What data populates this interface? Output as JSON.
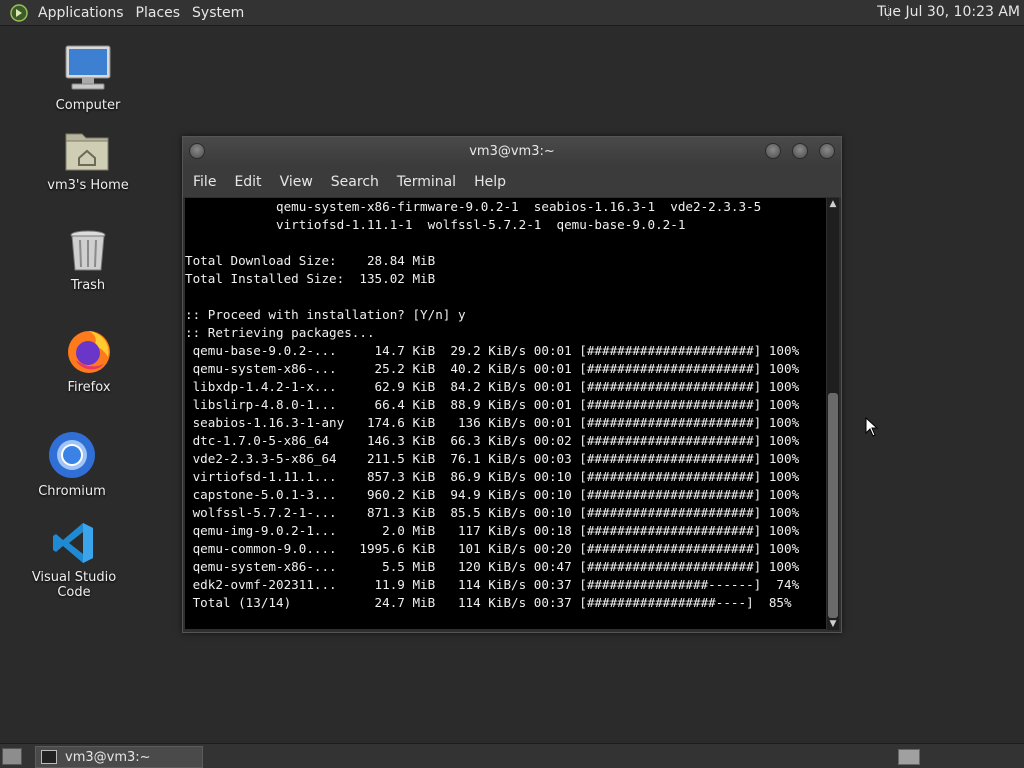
{
  "top_panel": {
    "menus": [
      "Applications",
      "Places",
      "System"
    ],
    "clock": "Tue Jul 30, 10:23 AM"
  },
  "desktop_icons": [
    {
      "label": "Computer",
      "icon": "computer-icon"
    },
    {
      "label": "vm3's Home",
      "icon": "home-folder-icon"
    },
    {
      "label": "Trash",
      "icon": "trash-icon"
    },
    {
      "label": "Firefox",
      "icon": "firefox-icon"
    },
    {
      "label": "Chromium",
      "icon": "chromium-icon"
    },
    {
      "label": "Visual Studio Code",
      "icon": "vscode-icon"
    }
  ],
  "terminal": {
    "title": "vm3@vm3:~",
    "menu": [
      "File",
      "Edit",
      "View",
      "Search",
      "Terminal",
      "Help"
    ],
    "lines": [
      "            qemu-system-x86-firmware-9.0.2-1  seabios-1.16.3-1  vde2-2.3.3-5",
      "            virtiofsd-1.11.1-1  wolfssl-5.7.2-1  qemu-base-9.0.2-1",
      "",
      "Total Download Size:    28.84 MiB",
      "Total Installed Size:  135.02 MiB",
      "",
      ":: Proceed with installation? [Y/n] y",
      ":: Retrieving packages...",
      " qemu-base-9.0.2-...     14.7 KiB  29.2 KiB/s 00:01 [######################] 100%",
      " qemu-system-x86-...     25.2 KiB  40.2 KiB/s 00:01 [######################] 100%",
      " libxdp-1.4.2-1-x...     62.9 KiB  84.2 KiB/s 00:01 [######################] 100%",
      " libslirp-4.8.0-1...     66.4 KiB  88.9 KiB/s 00:01 [######################] 100%",
      " seabios-1.16.3-1-any   174.6 KiB   136 KiB/s 00:01 [######################] 100%",
      " dtc-1.7.0-5-x86_64     146.3 KiB  66.3 KiB/s 00:02 [######################] 100%",
      " vde2-2.3.3-5-x86_64    211.5 KiB  76.1 KiB/s 00:03 [######################] 100%",
      " virtiofsd-1.11.1...    857.3 KiB  86.9 KiB/s 00:10 [######################] 100%",
      " capstone-5.0.1-3...    960.2 KiB  94.9 KiB/s 00:10 [######################] 100%",
      " wolfssl-5.7.2-1-...    871.3 KiB  85.5 KiB/s 00:10 [######################] 100%",
      " qemu-img-9.0.2-1...      2.0 MiB   117 KiB/s 00:18 [######################] 100%",
      " qemu-common-9.0....   1995.6 KiB   101 KiB/s 00:20 [######################] 100%",
      " qemu-system-x86-...      5.5 MiB   120 KiB/s 00:47 [######################] 100%",
      " edk2-ovmf-202311...     11.9 MiB   114 KiB/s 00:37 [################------]  74%",
      " Total (13/14)           24.7 MiB   114 KiB/s 00:37 [#################----]  85%"
    ]
  },
  "bottom_panel": {
    "task": "vm3@vm3:~"
  }
}
